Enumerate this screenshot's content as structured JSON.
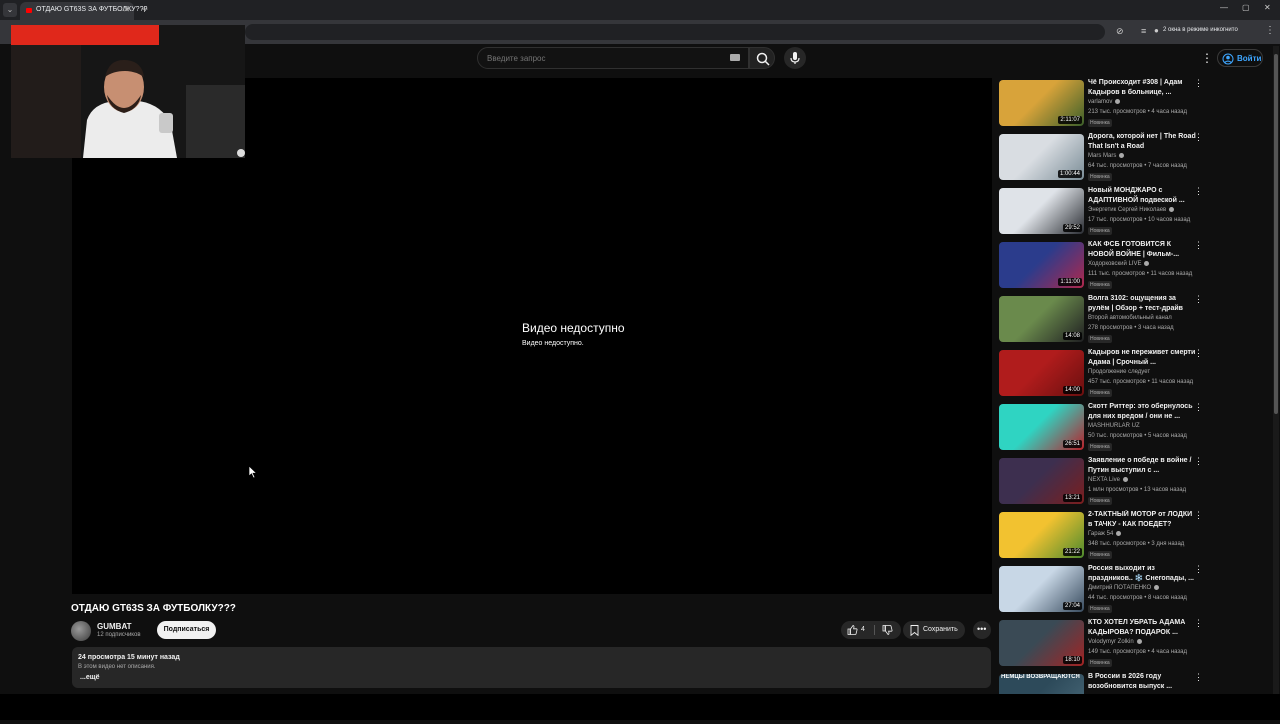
{
  "browser": {
    "tab_title": "ОТДАЮ GT63S ЗА ФУТБОЛКУ???",
    "incognito_label": "2 окна в режиме инкогнито",
    "icons": [
      "tab-list-icon",
      "youtube-favicon",
      "close-icon",
      "new-tab-icon",
      "minimize-icon",
      "maximize-icon",
      "close-window-icon",
      "eye-off-icon",
      "media-icon",
      "incognito-icon",
      "menu-icon"
    ]
  },
  "header": {
    "search_placeholder": "Введите запрос",
    "signin_label": "Войти"
  },
  "player": {
    "error_title": "Видео недоступно",
    "error_subtitle": "Видео недоступно."
  },
  "video": {
    "title": "ОТДАЮ GT63S ЗА ФУТБОЛКУ???",
    "channel_name": "GUMBAT",
    "subscribers": "12 подписчиков",
    "subscribe_label": "Подписаться",
    "likes": "4",
    "save_label": "Сохранить",
    "views_time": "24 просмотра  15 минут назад",
    "description": "В этом видео нет описания.",
    "more_label": "...ещё"
  },
  "recommendations": [
    {
      "title": "Чё Происходит #308 | Адам Кадыров в больнице, ...",
      "channel": "varlamov",
      "verified": true,
      "meta": "213 тыс. просмотров • 4 часа назад",
      "badge": "Новинка",
      "duration": "2:11:07",
      "overlay": "",
      "colors": [
        "#d8a33a",
        "#3c5f2a"
      ]
    },
    {
      "title": "Дорога, которой нет | The Road That Isn't a Road",
      "channel": "Mars Mars",
      "verified": true,
      "meta": "64 тыс. просмотров • 7 часов назад",
      "badge": "Новинка",
      "duration": "1:00:44",
      "overlay": "",
      "colors": [
        "#d9dde2",
        "#7a8c96"
      ]
    },
    {
      "title": "Новый МОНДЖАРО с АДАПТИВНОЙ подвеской ...",
      "channel": "Энергетик Сергей Николаев",
      "verified": true,
      "meta": "17 тыс. просмотров • 10 часов назад",
      "badge": "Новинка",
      "duration": "29:52",
      "overlay": "",
      "colors": [
        "#dfe3e8",
        "#2a2d33"
      ]
    },
    {
      "title": "КАК ФСБ ГОТОВИТСЯ К НОВОЙ ВОЙНЕ | Фильм-...",
      "channel": "Ходорковский LIVE",
      "verified": true,
      "meta": "111 тыс. просмотров • 11 часов назад",
      "badge": "Новинка",
      "duration": "1:11:00",
      "overlay": "",
      "colors": [
        "#2b3c8c",
        "#b0284c"
      ]
    },
    {
      "title": "Волга 3102: ощущения за рулём | Обзор + тест-драйв",
      "channel": "Второй автомобильный канал",
      "verified": false,
      "meta": "278 просмотров • 3 часа назад",
      "badge": "Новинка",
      "duration": "14:08",
      "overlay": "",
      "colors": [
        "#6a8a4c",
        "#1f1f22"
      ]
    },
    {
      "title": "Кадыров не переживет смерти Адама | Срочный ...",
      "channel": "Продолжение следует",
      "verified": false,
      "meta": "457 тыс. просмотров • 11 часов назад",
      "badge": "Новинка",
      "duration": "14:00",
      "overlay": "",
      "colors": [
        "#b01c1c",
        "#6a0f0f"
      ]
    },
    {
      "title": "Скотт Риттер: это обернулось для них вредом / они не ...",
      "channel": "MASHHURLAR UZ",
      "verified": false,
      "meta": "50 тыс. просмотров • 5 часов назад",
      "badge": "Новинка",
      "duration": "26:51",
      "overlay": "",
      "colors": [
        "#2fd4c2",
        "#b8212a"
      ]
    },
    {
      "title": "Заявление о победе в войне / Путин выступил с ...",
      "channel": "NEXTA Live",
      "verified": true,
      "meta": "1 млн просмотров • 13 часов назад",
      "badge": "Новинка",
      "duration": "13:21",
      "overlay": "",
      "colors": [
        "#3d2f4f",
        "#7b1e1e"
      ]
    },
    {
      "title": "2-ТАКТНЫЙ МОТОР от ЛОДКИ в ТАЧКУ - КАК ПОЕДЕТ?",
      "channel": "Гараж 54",
      "verified": true,
      "meta": "348 тыс. просмотров • 3 дня назад",
      "badge": "Новинка",
      "duration": "21:22",
      "overlay": "",
      "colors": [
        "#f2c230",
        "#4c8a2e"
      ]
    },
    {
      "title": "Россия выходит из праздников.. ❄️ Снегопады, ...",
      "channel": "Дмитрий ПОТАПЕНКО",
      "verified": true,
      "meta": "44 тыс. просмотров • 8 часов назад",
      "badge": "Новинка",
      "duration": "27:04",
      "overlay": "",
      "colors": [
        "#c8d7e6",
        "#384b5e"
      ]
    },
    {
      "title": "КТО ХОТЕЛ УБРАТЬ АДАМА КАДЫРОВА? ПОДАРОК ...",
      "channel": "Volodymyr Zolkin",
      "verified": true,
      "meta": "149 тыс. просмотров • 4 часа назад",
      "badge": "Новинка",
      "duration": "18:10",
      "overlay": "",
      "colors": [
        "#3a4a55",
        "#a32323"
      ]
    },
    {
      "title": "В России в 2026 году возобновится выпуск ...",
      "channel": "",
      "verified": false,
      "meta": "",
      "badge": "",
      "duration": "",
      "overlay": "НЕМЦЫ ВОЗВРАЩАЮТСЯ",
      "colors": [
        "#2d4a5a",
        "#4a6a7a"
      ]
    }
  ]
}
